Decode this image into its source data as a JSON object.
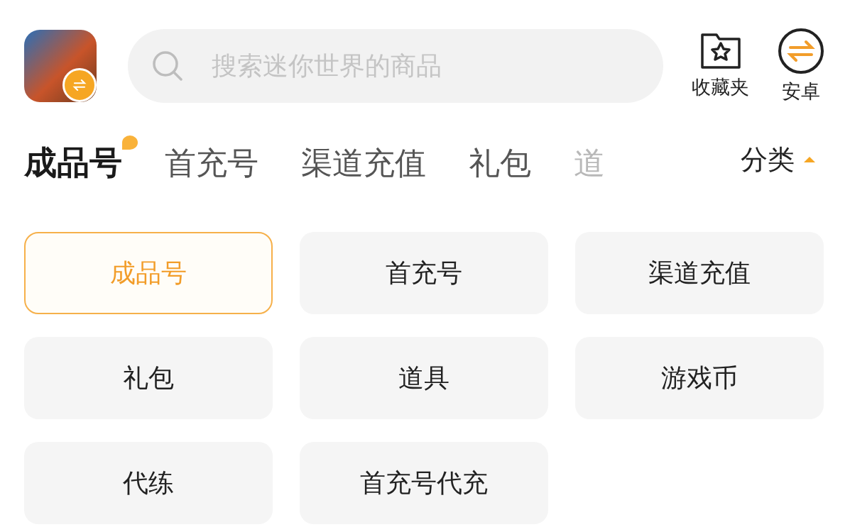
{
  "header": {
    "search": {
      "placeholder": "搜索迷你世界的商品"
    },
    "actions": [
      {
        "kind": "favorites",
        "label": "收藏夹"
      },
      {
        "kind": "platform",
        "label": "安卓"
      }
    ]
  },
  "tabs": [
    {
      "label": "成品号",
      "selected": true,
      "badge": true,
      "faded": false
    },
    {
      "label": "首充号",
      "selected": false,
      "badge": false,
      "faded": false
    },
    {
      "label": "渠道充值",
      "selected": false,
      "badge": false,
      "faded": false
    },
    {
      "label": "礼包",
      "selected": false,
      "badge": false,
      "faded": false
    },
    {
      "label": "道",
      "selected": false,
      "badge": false,
      "faded": true
    }
  ],
  "category_toggle": {
    "label": "分类",
    "expanded": true
  },
  "categories": [
    {
      "label": "成品号",
      "selected": true
    },
    {
      "label": "首充号",
      "selected": false
    },
    {
      "label": "渠道充值",
      "selected": false
    },
    {
      "label": "礼包",
      "selected": false
    },
    {
      "label": "道具",
      "selected": false
    },
    {
      "label": "游戏币",
      "selected": false
    },
    {
      "label": "代练",
      "selected": false
    },
    {
      "label": "首充号代充",
      "selected": false
    }
  ]
}
